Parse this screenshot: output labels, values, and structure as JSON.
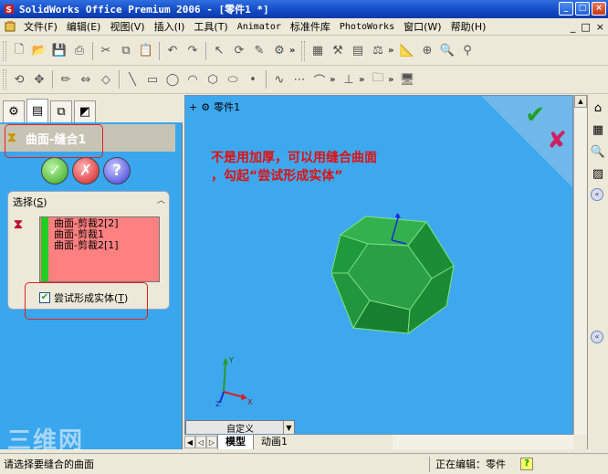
{
  "window": {
    "title": "SolidWorks Office Premium 2006 - [零件1 *]",
    "controls": [
      "_",
      "□",
      "×"
    ]
  },
  "menubar": {
    "items": [
      "文件(F)",
      "编辑(E)",
      "视图(V)",
      "插入(I)",
      "工具(T)",
      "Animator",
      "标准件库",
      "PhotoWorks",
      "窗口(W)",
      "帮助(H)"
    ],
    "mdi_controls": [
      "_",
      "□",
      "×"
    ]
  },
  "property_manager": {
    "tabs": [
      "feature-manager",
      "property-manager",
      "configuration-manager",
      "dim-expert"
    ],
    "feature_title": "曲面-缝合1",
    "buttons": {
      "ok": "✓",
      "cancel": "✗",
      "help": "?"
    },
    "selection_group": {
      "title": "选择",
      "title_key": "S",
      "items": [
        "曲面-剪裁2[2]",
        "曲面-剪裁1",
        "曲面-剪裁2[1]"
      ],
      "checkbox_label": "尝试形成实体",
      "checkbox_key": "T",
      "checkbox_checked": true
    }
  },
  "graphics": {
    "tree_root": "零件1",
    "annotation_line1": "不是用加厚，可以用缝合曲面",
    "annotation_line2": "，勾起“尝试形成实体”",
    "view_select": "自定义",
    "triad_labels": {
      "y": "Y",
      "z": "Z",
      "x": "X"
    }
  },
  "doc_tabs": [
    "模型",
    "动画1"
  ],
  "statusbar": {
    "message": "请选择要缝合的曲面",
    "editing": "正在编辑：零件",
    "help": "?"
  },
  "watermark": "三维网",
  "colors": {
    "graphics_bg": "#3ea8ee",
    "solid_fill": "#1e9a3c",
    "annotation": "#e01010",
    "selection_list": "#ff8080"
  }
}
